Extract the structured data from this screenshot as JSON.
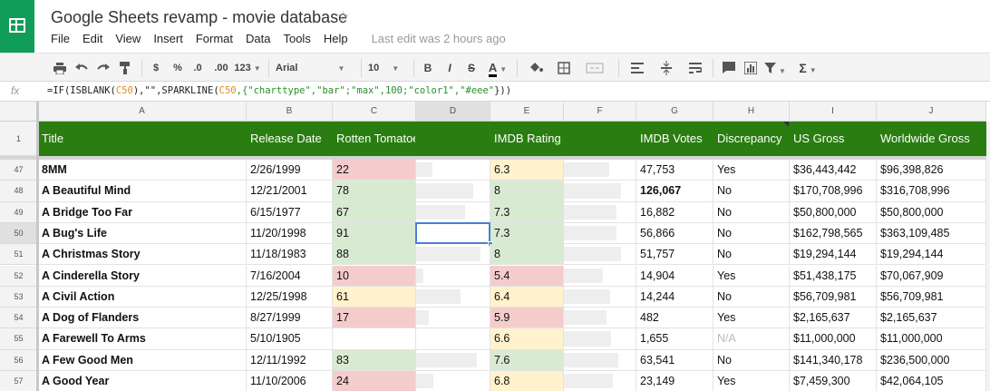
{
  "app": {
    "doc_title": "Google Sheets revamp - movie database",
    "last_edit": "Last edit was 2 hours ago",
    "colors": {
      "brand": "#0f9d58",
      "header_row": "#2a7d10",
      "red": "#f4cccc",
      "yellow": "#fff2cc",
      "green": "#d9ead3",
      "selection": "#4a7fd6"
    }
  },
  "menu": [
    "File",
    "Edit",
    "View",
    "Insert",
    "Format",
    "Data",
    "Tools",
    "Help"
  ],
  "toolbar": {
    "icons": [
      "print-icon",
      "undo-icon",
      "redo-icon",
      "paint-format-icon"
    ],
    "currency": "$",
    "percent": "%",
    "dec_decrease": ".0",
    "dec_increase": ".00",
    "more_formats": "123",
    "font": "Arial",
    "font_size": "10",
    "bold": "B",
    "italic": "I",
    "strike": "S",
    "text_color": "A",
    "sum": "Σ"
  },
  "formula_bar": {
    "fx": "fx",
    "parts": [
      {
        "t": "=IF(ISBLANK(",
        "c": ""
      },
      {
        "t": "C50",
        "c": "ref"
      },
      {
        "t": "),\"\",SPARKLINE(",
        "c": ""
      },
      {
        "t": "C50",
        "c": "ref"
      },
      {
        "t": ",{\"charttype\",\"bar\";\"max\",100;\"color1\",",
        "c": "str"
      },
      {
        "t": "\"#eee\"",
        "c": "str"
      },
      {
        "t": "}))",
        "c": ""
      }
    ]
  },
  "columns": [
    "A",
    "B",
    "C",
    "D",
    "E",
    "F",
    "G",
    "H",
    "I",
    "J"
  ],
  "header_row": {
    "row_number": "1",
    "cells": [
      "Title",
      "Release Date",
      "Rotten Tomatoes Rating",
      "",
      "IMDB Rating",
      "",
      "IMDB Votes",
      "Discrepancy",
      "US Gross",
      "Worldwide Gross"
    ]
  },
  "rows": [
    {
      "num": "47",
      "title": "8MM",
      "date": "2/26/1999",
      "rt": "22",
      "rt_color": "red",
      "rt_spark": 0.22,
      "imdb": "6.3",
      "imdb_color": "yellow",
      "imdb_spark": 0.63,
      "votes": "47,753",
      "votes_bold": false,
      "disc": "Yes",
      "us": "$36,443,442",
      "ww": "$96,398,826"
    },
    {
      "num": "48",
      "title": "A Beautiful Mind",
      "date": "12/21/2001",
      "rt": "78",
      "rt_color": "green",
      "rt_spark": 0.78,
      "imdb": "8",
      "imdb_color": "green",
      "imdb_spark": 0.8,
      "votes": "126,067",
      "votes_bold": true,
      "disc": "No",
      "us": "$170,708,996",
      "ww": "$316,708,996"
    },
    {
      "num": "49",
      "title": "A Bridge Too Far",
      "date": "6/15/1977",
      "rt": "67",
      "rt_color": "green",
      "rt_spark": 0.67,
      "imdb": "7.3",
      "imdb_color": "green",
      "imdb_spark": 0.73,
      "votes": "16,882",
      "votes_bold": false,
      "disc": "No",
      "us": "$50,800,000",
      "ww": "$50,800,000"
    },
    {
      "num": "50",
      "title": "A Bug's Life",
      "date": "11/20/1998",
      "rt": "91",
      "rt_color": "green",
      "rt_spark": 0,
      "imdb": "7.3",
      "imdb_color": "green",
      "imdb_spark": 0.73,
      "votes": "56,866",
      "votes_bold": false,
      "disc": "No",
      "us": "$162,798,565",
      "ww": "$363,109,485"
    },
    {
      "num": "51",
      "title": "A Christmas Story",
      "date": "11/18/1983",
      "rt": "88",
      "rt_color": "green",
      "rt_spark": 0.88,
      "imdb": "8",
      "imdb_color": "green",
      "imdb_spark": 0.8,
      "votes": "51,757",
      "votes_bold": false,
      "disc": "No",
      "us": "$19,294,144",
      "ww": "$19,294,144"
    },
    {
      "num": "52",
      "title": "A Cinderella Story",
      "date": "7/16/2004",
      "rt": "10",
      "rt_color": "red",
      "rt_spark": 0.1,
      "imdb": "5.4",
      "imdb_color": "red",
      "imdb_spark": 0.54,
      "votes": "14,904",
      "votes_bold": false,
      "disc": "Yes",
      "us": "$51,438,175",
      "ww": "$70,067,909"
    },
    {
      "num": "53",
      "title": "A Civil Action",
      "date": "12/25/1998",
      "rt": "61",
      "rt_color": "yellow",
      "rt_spark": 0.61,
      "imdb": "6.4",
      "imdb_color": "yellow",
      "imdb_spark": 0.64,
      "votes": "14,244",
      "votes_bold": false,
      "disc": "No",
      "us": "$56,709,981",
      "ww": "$56,709,981"
    },
    {
      "num": "54",
      "title": "A Dog of Flanders",
      "date": "8/27/1999",
      "rt": "17",
      "rt_color": "red",
      "rt_spark": 0.17,
      "imdb": "5.9",
      "imdb_color": "red",
      "imdb_spark": 0.59,
      "votes": "482",
      "votes_bold": false,
      "disc": "Yes",
      "us": "$2,165,637",
      "ww": "$2,165,637"
    },
    {
      "num": "55",
      "title": "A Farewell To Arms",
      "date": "5/10/1905",
      "rt": "",
      "rt_color": "",
      "rt_spark": 0,
      "imdb": "6.6",
      "imdb_color": "yellow",
      "imdb_spark": 0.66,
      "votes": "1,655",
      "votes_bold": false,
      "disc": "N/A",
      "us": "$11,000,000",
      "ww": "$11,000,000"
    },
    {
      "num": "56",
      "title": "A Few Good Men",
      "date": "12/11/1992",
      "rt": "83",
      "rt_color": "green",
      "rt_spark": 0.83,
      "imdb": "7.6",
      "imdb_color": "green",
      "imdb_spark": 0.76,
      "votes": "63,541",
      "votes_bold": false,
      "disc": "No",
      "us": "$141,340,178",
      "ww": "$236,500,000"
    },
    {
      "num": "57",
      "title": "A Good Year",
      "date": "11/10/2006",
      "rt": "24",
      "rt_color": "red",
      "rt_spark": 0.24,
      "imdb": "6.8",
      "imdb_color": "yellow",
      "imdb_spark": 0.68,
      "votes": "23,149",
      "votes_bold": false,
      "disc": "Yes",
      "us": "$7,459,300",
      "ww": "$42,064,105"
    }
  ],
  "selected": {
    "row": "50",
    "column": "D"
  }
}
